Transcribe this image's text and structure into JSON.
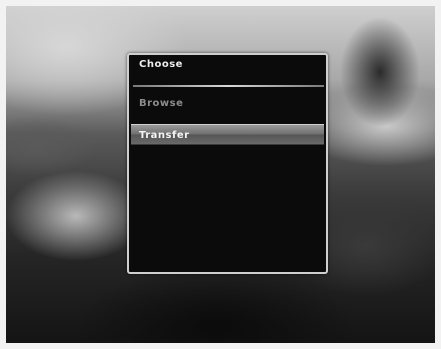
{
  "menu": {
    "title": "Choose",
    "items": [
      {
        "label": "Browse",
        "selected": false
      },
      {
        "label": "Transfer",
        "selected": true
      }
    ]
  },
  "colors": {
    "menu_background": "#0b0b0b",
    "menu_border": "#cfcfcf",
    "highlight": "#7a7a7a",
    "inactive_text": "#8c8c8c",
    "active_text": "#f4f4f4"
  }
}
